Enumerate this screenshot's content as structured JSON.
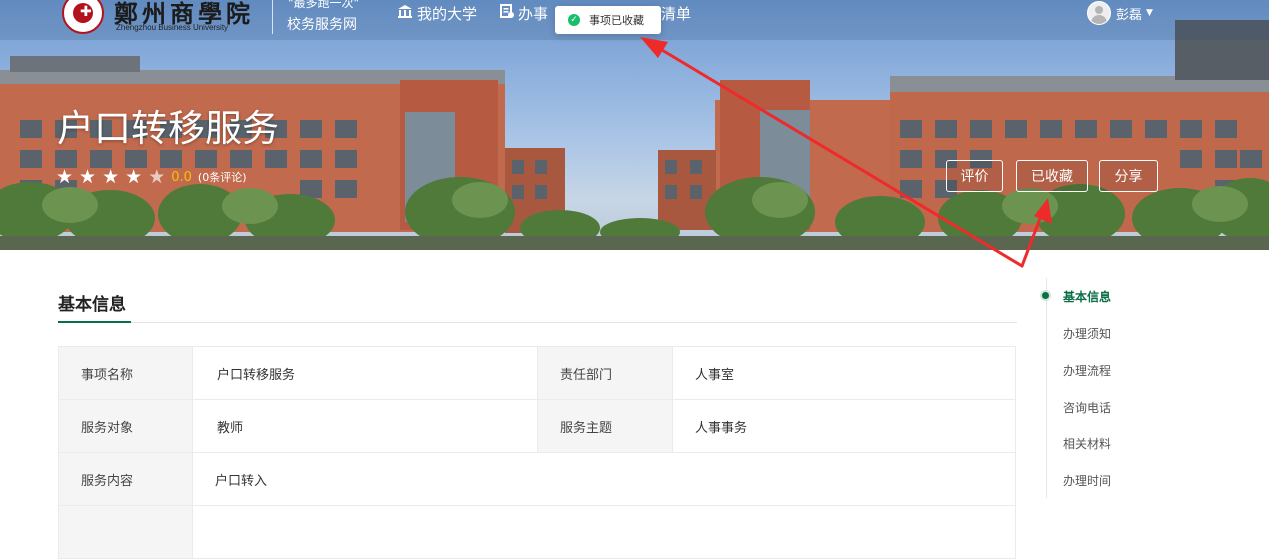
{
  "header": {
    "logo_cn": "鄭州商學院",
    "logo_en": "Zhengzhou Business University",
    "slogan": "\"最多跑一次\"",
    "site_name": "校务服务网",
    "nav": [
      {
        "label": "我的大学",
        "icon": "university-icon"
      },
      {
        "label": "办事",
        "icon": "document-icon"
      },
      {
        "label": "清单",
        "icon": ""
      }
    ],
    "user_name": "彭磊"
  },
  "toast": {
    "message": "事项已收藏",
    "icon": "check-circle-icon",
    "color": "#19be6b"
  },
  "hero": {
    "service_title": "户口转移服务",
    "rating": {
      "stars_filled": 4,
      "stars_total": 5,
      "score": "0.0",
      "review_count": "(0条评论)"
    },
    "buttons": {
      "rate": "评价",
      "favorite": "已收藏",
      "share": "分享"
    }
  },
  "basic_info": {
    "title": "基本信息",
    "rows": [
      {
        "label1": "事项名称",
        "value1": "户口转移服务",
        "label2": "责任部门",
        "value2": "人事室"
      },
      {
        "label1": "服务对象",
        "value1": "教师",
        "label2": "服务主题",
        "value2": "人事事务"
      },
      {
        "label1": "服务内容",
        "value1": "户口转入"
      }
    ]
  },
  "side_nav": {
    "items": [
      "基本信息",
      "办理须知",
      "办理流程",
      "咨询电话",
      "相关材料",
      "办理时间"
    ],
    "active": "基本信息"
  },
  "colors": {
    "accent": "#0a6e46",
    "brand_red": "#b3121c",
    "annotation": "#ee2a2a"
  }
}
